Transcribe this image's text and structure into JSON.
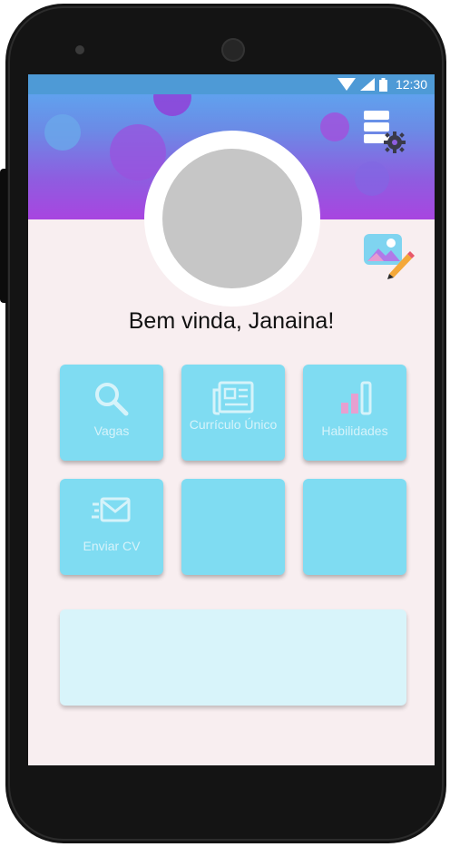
{
  "status_bar": {
    "time": "12:30",
    "icons": [
      "wifi-icon",
      "signal-icon",
      "battery-icon"
    ]
  },
  "header": {
    "settings_icon": "settings-menu-icon",
    "edit_photo_icon": "edit-image-icon"
  },
  "welcome": {
    "text": "Bem vinda, Janaina!"
  },
  "tiles": [
    {
      "label": "Vagas",
      "icon": "search-icon"
    },
    {
      "label": "Currículo Único",
      "icon": "resume-icon"
    },
    {
      "label": "Habilidades",
      "icon": "bar-chart-icon"
    },
    {
      "label": "Enviar CV",
      "icon": "send-mail-icon"
    },
    {
      "label": "",
      "icon": ""
    },
    {
      "label": "",
      "icon": ""
    }
  ],
  "colors": {
    "header_top": "#5aaef2",
    "header_bottom": "#a845e0",
    "tile": "#7fdcf2",
    "banner": "#d8f4fa",
    "background": "#f8eef0"
  }
}
